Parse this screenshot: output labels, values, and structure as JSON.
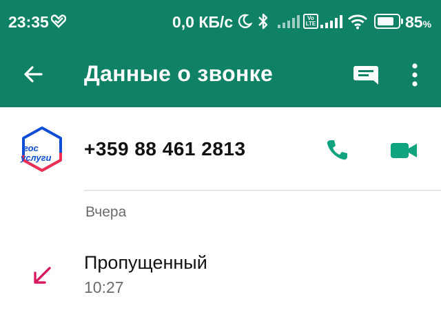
{
  "status_bar": {
    "time": "23:35",
    "net_speed": "0,0 КБ/с",
    "volte": "Vo LTE",
    "battery_number": "85",
    "battery_unit": "%",
    "battery_level": 0.85
  },
  "app_bar": {
    "title": "Данные о звонке",
    "icons": [
      "back-arrow-icon",
      "message-icon",
      "more-vert-icon"
    ]
  },
  "contact": {
    "phone": "+359 88 461 2813",
    "logo_text_line1": "гос",
    "logo_text_line2": "услуги"
  },
  "calls": {
    "section_label": "Вчера",
    "entries": [
      {
        "type": "Пропущенный",
        "time": "10:27",
        "icon": "missed-call-arrow-icon"
      }
    ]
  },
  "colors": {
    "header": "#0f8266",
    "accent": "#0fa37f",
    "missed": "#d81b60",
    "logo_blue": "#0d4cd3",
    "logo_red": "#ee2f53"
  }
}
